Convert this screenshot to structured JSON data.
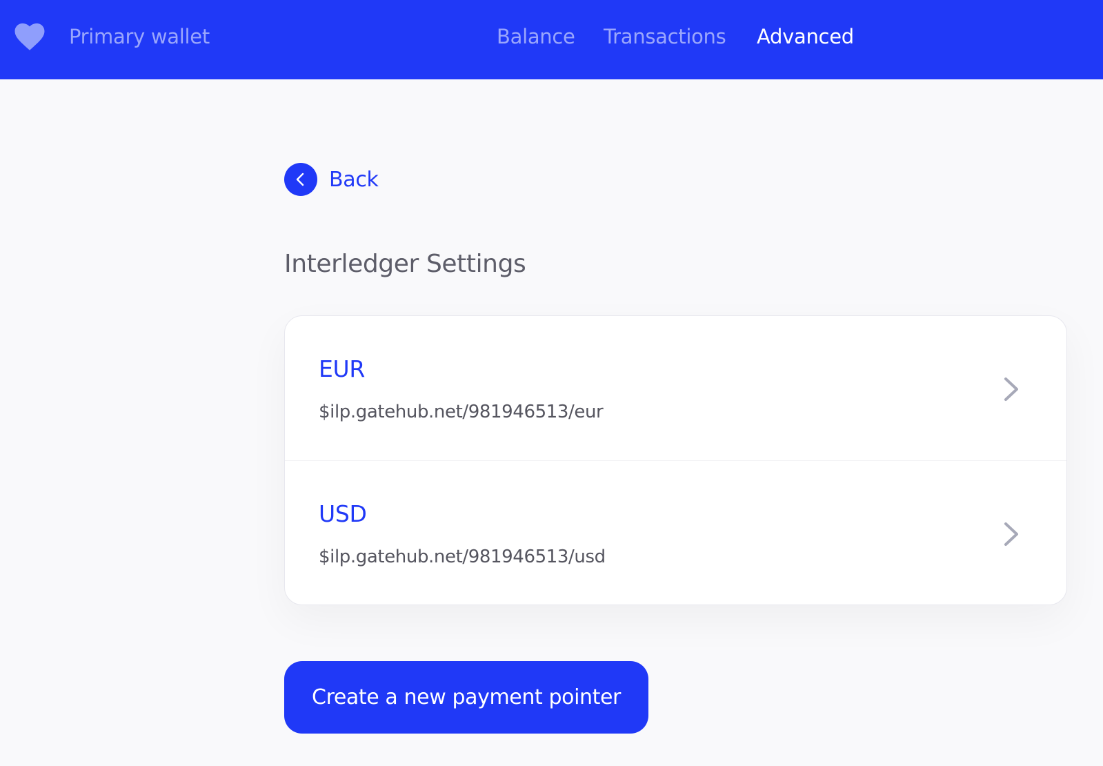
{
  "header": {
    "logo_icon": "heart-icon",
    "wallet_name": "Primary wallet",
    "nav": {
      "balance": "Balance",
      "transactions": "Transactions",
      "advanced": "Advanced",
      "active": "Advanced"
    }
  },
  "main": {
    "back_label": "Back",
    "back_icon": "chevron-left-icon",
    "title": "Interledger Settings",
    "accounts": [
      {
        "currency": "EUR",
        "payment_pointer": "$ilp.gatehub.net/981946513/eur",
        "icon": "chevron-right-icon"
      },
      {
        "currency": "USD",
        "payment_pointer": "$ilp.gatehub.net/981946513/usd",
        "icon": "chevron-right-icon"
      }
    ],
    "create_button_label": "Create a new payment pointer"
  },
  "colors": {
    "brand": "#2039f7",
    "nav_inactive": "#9aa6fc",
    "background": "#f9f9fb",
    "card": "#ffffff",
    "title_text": "#5d5d69",
    "chevron": "#a7a9b8"
  }
}
